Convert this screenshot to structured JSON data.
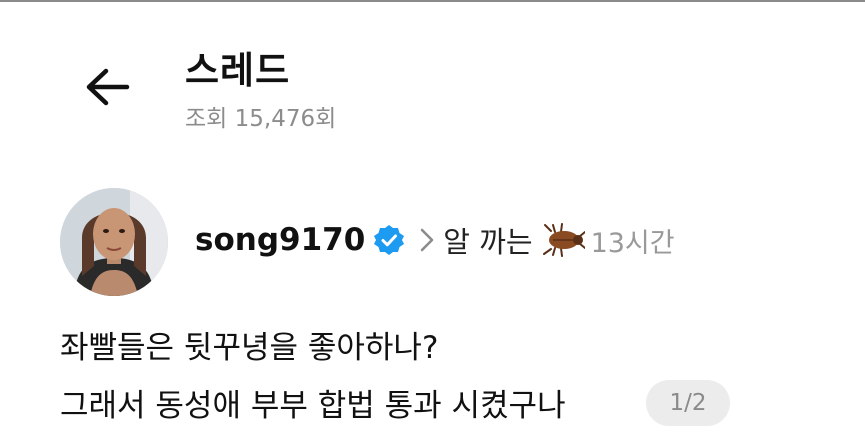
{
  "header": {
    "title": "스레드",
    "views": "조회 15,476회"
  },
  "author": {
    "username": "song9170",
    "topic": "알 까는",
    "time": "13시간"
  },
  "post": {
    "line1": "좌빨들은 뒷꾸녕을 좋아하나?",
    "line2": "그래서 동성애 부부 합법 통과 시켰구나",
    "page_indicator": "1/2"
  },
  "icons": {
    "back": "arrow-left-icon",
    "verified": "verified-badge-icon",
    "chevron": "chevron-right-icon",
    "bug": "cockroach-icon"
  },
  "colors": {
    "verified": "#1d9bf0",
    "muted": "#8c8c8c",
    "badge_bg": "#ececec"
  }
}
